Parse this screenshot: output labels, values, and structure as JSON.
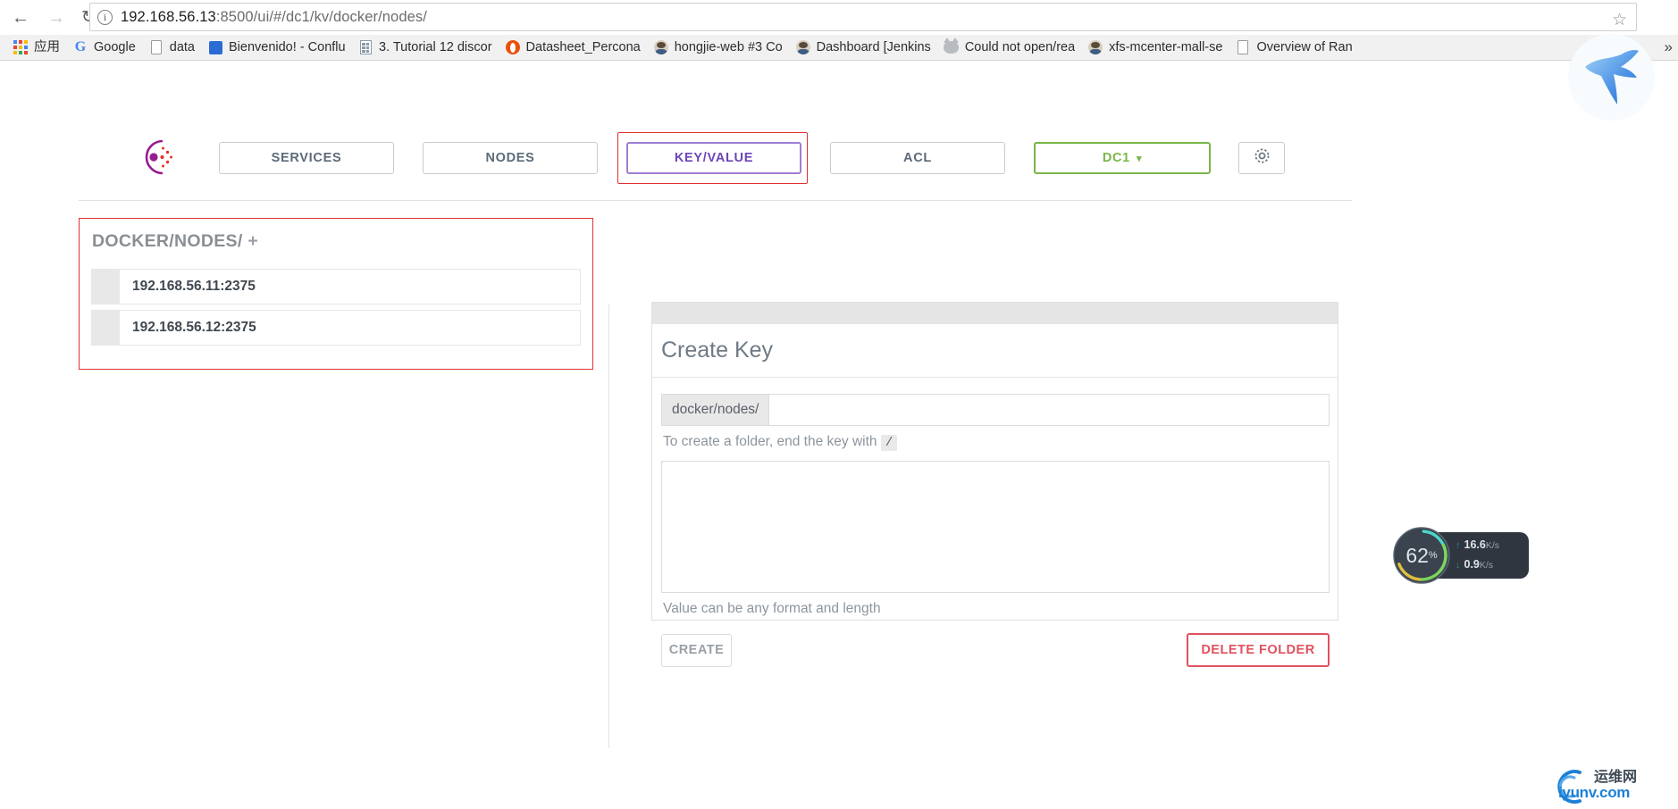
{
  "browser": {
    "back_icon": "back-arrow-icon",
    "forward_icon": "forward-arrow-icon",
    "reload_icon": "reload-icon",
    "info_icon": "page-info-icon",
    "url_host": "192.168.56.13",
    "url_rest": ":8500/ui/#/dc1/kv/docker/nodes/",
    "url_full": "192.168.56.13:8500/ui/#/dc1/kv/docker/nodes/",
    "star_icon": "bookmark-star-icon",
    "overflow_label": "»",
    "bookmarks": [
      {
        "label": "应用",
        "icon": "apps-grid-icon"
      },
      {
        "label": "Google",
        "icon": "google-g-icon"
      },
      {
        "label": "data",
        "icon": "document-icon"
      },
      {
        "label": "Bienvenido! - Conflu",
        "icon": "confluence-icon"
      },
      {
        "label": "3. Tutorial 12 discor",
        "icon": "building-icon"
      },
      {
        "label": "Datasheet_Percona",
        "icon": "opera-icon"
      },
      {
        "label": "hongjie-web #3 Co",
        "icon": "jenkins-person-icon"
      },
      {
        "label": "Dashboard [Jenkins",
        "icon": "jenkins-person-icon"
      },
      {
        "label": "Could not open/rea",
        "icon": "cat-icon"
      },
      {
        "label": "xfs-mcenter-mall-se",
        "icon": "jenkins-person-icon"
      },
      {
        "label": "Overview of Ran",
        "icon": "document-icon"
      }
    ]
  },
  "consul": {
    "logo_icon": "consul-logo-icon",
    "tabs": [
      {
        "label": "SERVICES",
        "name": "services",
        "state": "default"
      },
      {
        "label": "NODES",
        "name": "nodes",
        "state": "default"
      },
      {
        "label": "KEY/VALUE",
        "name": "key-value",
        "state": "active"
      },
      {
        "label": "ACL",
        "name": "acl",
        "state": "default"
      }
    ],
    "datacenter": {
      "label": "DC1",
      "caret": "▾"
    },
    "settings_icon": "gear-icon",
    "colors": {
      "active_tab_border": "#9d7fd4",
      "active_tab_text": "#6d46b8",
      "dc_green": "#7ab648",
      "highlight_red": "#e03131",
      "delete_red": "#e05260"
    }
  },
  "kv_panel": {
    "title": "DOCKER/NODES/",
    "add_label": "+",
    "items": [
      {
        "label": "192.168.56.11:2375"
      },
      {
        "label": "192.168.56.12:2375"
      }
    ]
  },
  "create_key": {
    "title": "Create Key",
    "prefix": "docker/nodes/",
    "key_value": "",
    "key_placeholder": "",
    "key_hint_text": "To create a folder, end the key with",
    "key_hint_code": "/",
    "value_text": "",
    "value_placeholder": "",
    "value_hint": "Value can be any format and length",
    "create_label": "CREATE",
    "delete_label": "DELETE FOLDER"
  },
  "netspeed": {
    "percent": "62",
    "percent_unit": "%",
    "upload": {
      "arrow": "↑",
      "value": "16.6",
      "unit": "K/s"
    },
    "download": {
      "arrow": "↓",
      "value": "0.9",
      "unit": "K/s"
    }
  },
  "overlays": {
    "cursor_icon": "bird-cursor-icon",
    "watermark_text": "iyunv.com",
    "watermark_cn": "运维网"
  }
}
